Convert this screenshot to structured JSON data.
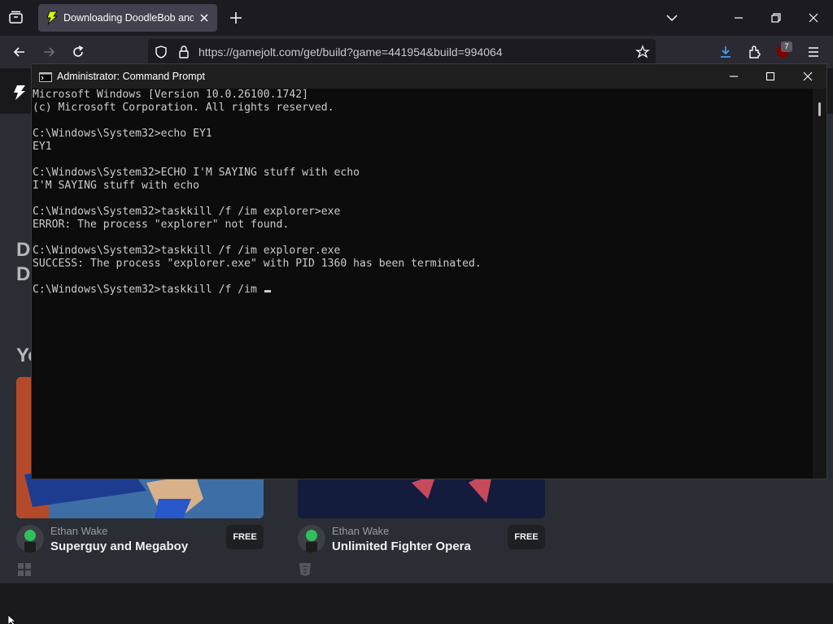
{
  "browser": {
    "tab_title": "Downloading DoodleBob and t",
    "url": "https://gamejolt.com/get/build?game=441954&build=994064",
    "extension_badge": "7",
    "accent_color": "#45a1ff"
  },
  "page": {
    "hero_lines": [
      "D",
      "D"
    ],
    "section_title": "Yo",
    "cards": [
      {
        "author": "Ethan Wake",
        "title": "Superguy and Megaboy",
        "price": "FREE",
        "platform_icon": "windows-icon"
      },
      {
        "author": "Ethan Wake",
        "title": "Unlimited Fighter Opera",
        "price": "FREE",
        "platform_icon": "html5-icon"
      }
    ]
  },
  "cmd": {
    "title": "Administrator: Command Prompt",
    "lines": [
      "Microsoft Windows [Version 10.0.26100.1742]",
      "(c) Microsoft Corporation. All rights reserved.",
      "",
      "C:\\Windows\\System32>echo EY1",
      "EY1",
      "",
      "C:\\Windows\\System32>ECHO I'M SAYING stuff with echo",
      "I'M SAYING stuff with echo",
      "",
      "C:\\Windows\\System32>taskkill /f /im explorer>exe",
      "ERROR: The process \"explorer\" not found.",
      "",
      "C:\\Windows\\System32>taskkill /f /im explorer.exe",
      "SUCCESS: The process \"explorer.exe\" with PID 1360 has been terminated.",
      ""
    ],
    "current_input": "C:\\Windows\\System32>taskkill /f /im "
  }
}
